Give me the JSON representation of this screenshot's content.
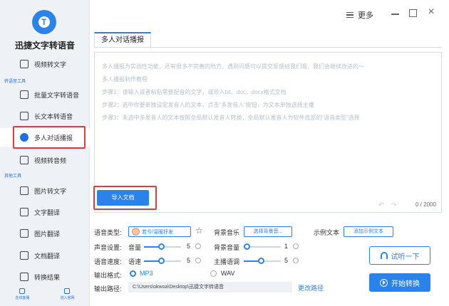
{
  "app": {
    "name": "迅捷文字转语音"
  },
  "sidebar": {
    "top_item": "视频转文字",
    "section_speech": "转语音工具",
    "speech_items": [
      "批量文字转语音",
      "长文本转语音",
      "多人对话播报",
      "视频转音频"
    ],
    "section_other": "其他工具",
    "other_items": [
      "图片转文字",
      "文字翻译",
      "图片翻译",
      "文档翻译",
      "转换结果"
    ],
    "bottom_tools": [
      "在线客服",
      "进入官网"
    ]
  },
  "titlebar": {
    "menu_label": "更多"
  },
  "tab": {
    "label": "多人对话播报"
  },
  "editor": {
    "hints": [
      "多人播报为实验性功能，还有很多不完善的地方，遇到问题可以提交反馈给我们哦，我们会继续改进的～",
      "多人播报制作教程",
      "步骤1：请输入或者粘贴需要配音的文字，或导入txt、doc、docx格式文档",
      "步骤2：选中你要单独设定发音人的文本，点击“多发音人”按钮，为文本单独选择主播",
      "步骤3：未选中多发音人的文本按照全局默认发音人转换，全局默认发音人为软件底部的“语音类型”选择"
    ],
    "import_label": "导入文档",
    "count": "0 / 2000"
  },
  "settings": {
    "voice_type_label": "语音类型:",
    "voice_name": "若兮/温暖抒发",
    "bg_music_label": "背景音乐",
    "choose_bg_label": "选择背景音...",
    "sample_label": "示例文本",
    "add_sample_label": "添加示例文本",
    "voice_settings_label": "声音设置:",
    "volume_label": "音量",
    "volume_value": "5",
    "bg_volume_label": "背景音量",
    "bg_volume_value": "1",
    "speed_label": "语音速度:",
    "rate_label": "语速",
    "rate_value": "5",
    "pitch_label": "主播语调",
    "pitch_value": "5",
    "format_label": "输出格式:",
    "format_mp3": "MP3",
    "format_wav": "WAV",
    "path_label": "输出路径:",
    "path_value": "C:\\Users\\okwoa\\Desktop\\迅捷文字转语音",
    "change_path": "更改路径",
    "listen_label": "试听一下",
    "start_label": "开始转换"
  },
  "colors": {
    "accent": "#2b82e8",
    "highlight": "#e23b3b"
  }
}
